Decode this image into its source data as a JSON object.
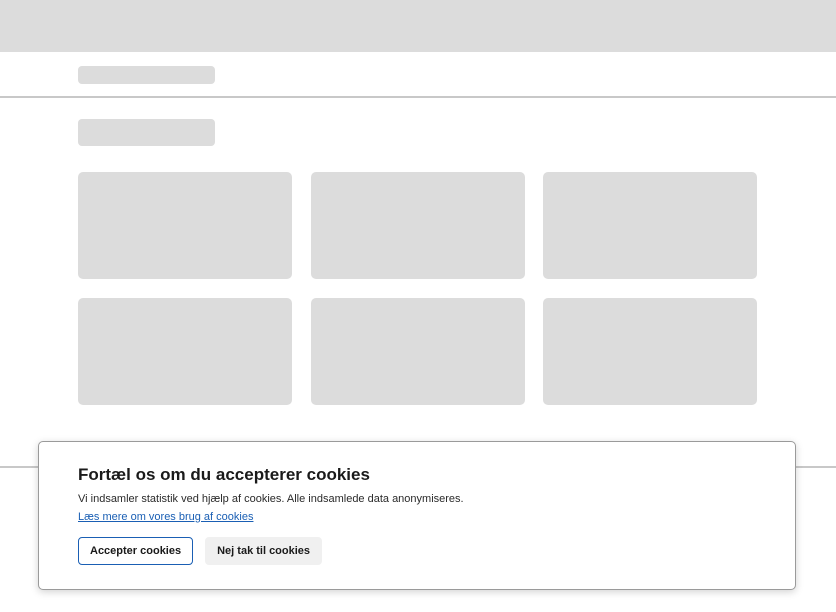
{
  "cookie_banner": {
    "title": "Fortæl os om du accepterer cookies",
    "description": "Vi indsamler statistik ved hjælp af cookies. Alle indsamlede data anonymiseres.",
    "link_text": "Læs mere om vores brug af cookies",
    "accept_label": "Accepter cookies",
    "decline_label": "Nej tak til cookies"
  },
  "colors": {
    "skeleton": "#dcdcdc",
    "accent": "#1a5fb4",
    "divider": "#c8c8c8"
  }
}
